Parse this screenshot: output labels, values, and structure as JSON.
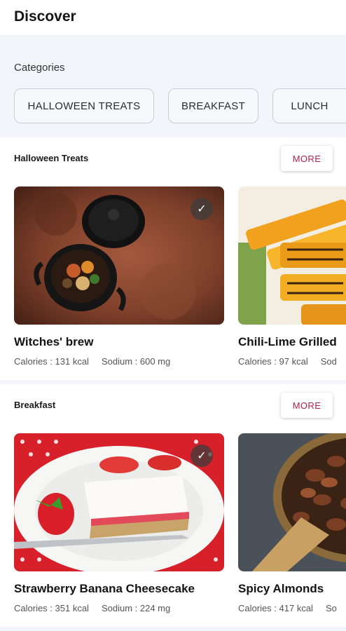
{
  "header": {
    "title": "Discover"
  },
  "categories": {
    "label": "Categories",
    "chips": [
      "HALLOWEEN TREATS",
      "BREAKFAST",
      "LUNCH"
    ]
  },
  "sections": [
    {
      "title": "Halloween Treats",
      "more_label": "MORE",
      "cards": [
        {
          "name": "Witches' brew",
          "calories": "Calories : 131 kcal",
          "sodium": "Sodium : 600 mg",
          "checked": true,
          "image": "cast-iron-pot-stew"
        },
        {
          "name": "Chili-Lime Grilled",
          "calories": "Calories : 97 kcal",
          "sodium": "Sod",
          "checked": false,
          "image": "grilled-pineapple"
        }
      ]
    },
    {
      "title": "Breakfast",
      "more_label": "MORE",
      "cards": [
        {
          "name": "Strawberry Banana Cheesecake",
          "calories": "Calories : 351 kcal",
          "sodium": "Sodium : 224 mg",
          "checked": true,
          "image": "cheesecake-slice"
        },
        {
          "name": "Spicy Almonds",
          "calories": "Calories : 417 kcal",
          "sodium": "So",
          "checked": false,
          "image": "bowl-of-almonds"
        }
      ]
    }
  ],
  "icons": {
    "check": "check-icon"
  },
  "colors": {
    "accent": "#b3204d",
    "background": "#f3f5fb",
    "card_surface": "#ffffff"
  }
}
